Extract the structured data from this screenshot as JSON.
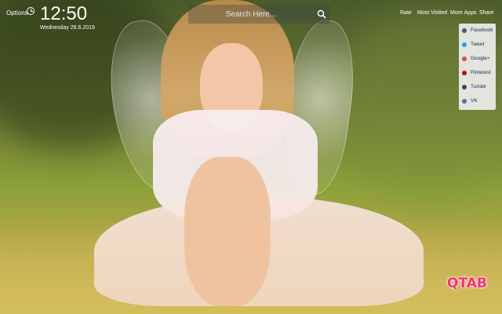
{
  "header": {
    "options_label": "Options",
    "time": "12:50",
    "date": "Wednesday 26.6.2019"
  },
  "search": {
    "placeholder": "Search Here..."
  },
  "top_menu": {
    "rate": "Rate",
    "most_visited": "Most Visited",
    "more_apps": "More Apps",
    "share": "Share"
  },
  "share_menu": {
    "items": [
      {
        "label": "Facebook",
        "icon": "facebook-icon",
        "color": "#3b5998"
      },
      {
        "label": "Tweet",
        "icon": "twitter-icon",
        "color": "#1da1f2"
      },
      {
        "label": "Google+",
        "icon": "google-plus-icon",
        "color": "#dd4b39"
      },
      {
        "label": "Pinterest",
        "icon": "pinterest-icon",
        "color": "#bd081c"
      },
      {
        "label": "Tumblr",
        "icon": "tumblr-icon",
        "color": "#35465c"
      },
      {
        "label": "VK",
        "icon": "vk-icon",
        "color": "#4a76a8"
      }
    ]
  },
  "brand": {
    "logo_text": "QTAB",
    "logo_color": "#ff2d7a"
  }
}
